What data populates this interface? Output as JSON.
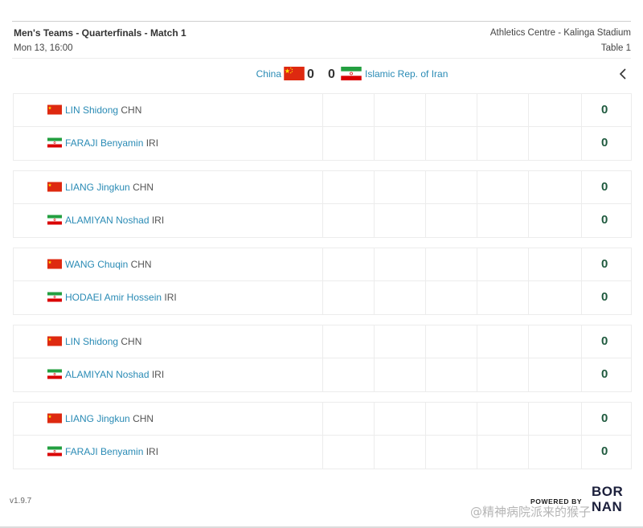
{
  "header": {
    "title": "Men's Teams - Quarterfinals - Match 1",
    "datetime": "Mon 13, 16:00",
    "venue": "Athletics Centre - Kalinga Stadium",
    "table": "Table 1"
  },
  "teams": {
    "home": {
      "name": "China",
      "score": "0",
      "flag": "china-flag-icon"
    },
    "away": {
      "name": "Islamic Rep. of Iran",
      "score": "0",
      "flag": "iran-flag-icon"
    }
  },
  "matches": [
    {
      "p1": {
        "name": "LIN Shidong",
        "code": "CHN",
        "score": "0"
      },
      "p2": {
        "name": "FARAJI Benyamin",
        "code": "IRI",
        "score": "0"
      }
    },
    {
      "p1": {
        "name": "LIANG Jingkun",
        "code": "CHN",
        "score": "0"
      },
      "p2": {
        "name": "ALAMIYAN Noshad",
        "code": "IRI",
        "score": "0"
      }
    },
    {
      "p1": {
        "name": "WANG Chuqin",
        "code": "CHN",
        "score": "0"
      },
      "p2": {
        "name": "HODAEI Amir Hossein",
        "code": "IRI",
        "score": "0"
      }
    },
    {
      "p1": {
        "name": "LIN Shidong",
        "code": "CHN",
        "score": "0"
      },
      "p2": {
        "name": "ALAMIYAN Noshad",
        "code": "IRI",
        "score": "0"
      }
    },
    {
      "p1": {
        "name": "LIANG Jingkun",
        "code": "CHN",
        "score": "0"
      },
      "p2": {
        "name": "FARAJI Benyamin",
        "code": "IRI",
        "score": "0"
      }
    }
  ],
  "footer": {
    "version": "v1.9.7",
    "powered_by": "POWERED BY",
    "brand_line1": "BOR",
    "brand_line2": "NAN",
    "watermark": "@精神病院派来的猴子"
  },
  "colors": {
    "link": "#2a8bb5",
    "score": "#1f5a3e",
    "border": "#ececec"
  }
}
